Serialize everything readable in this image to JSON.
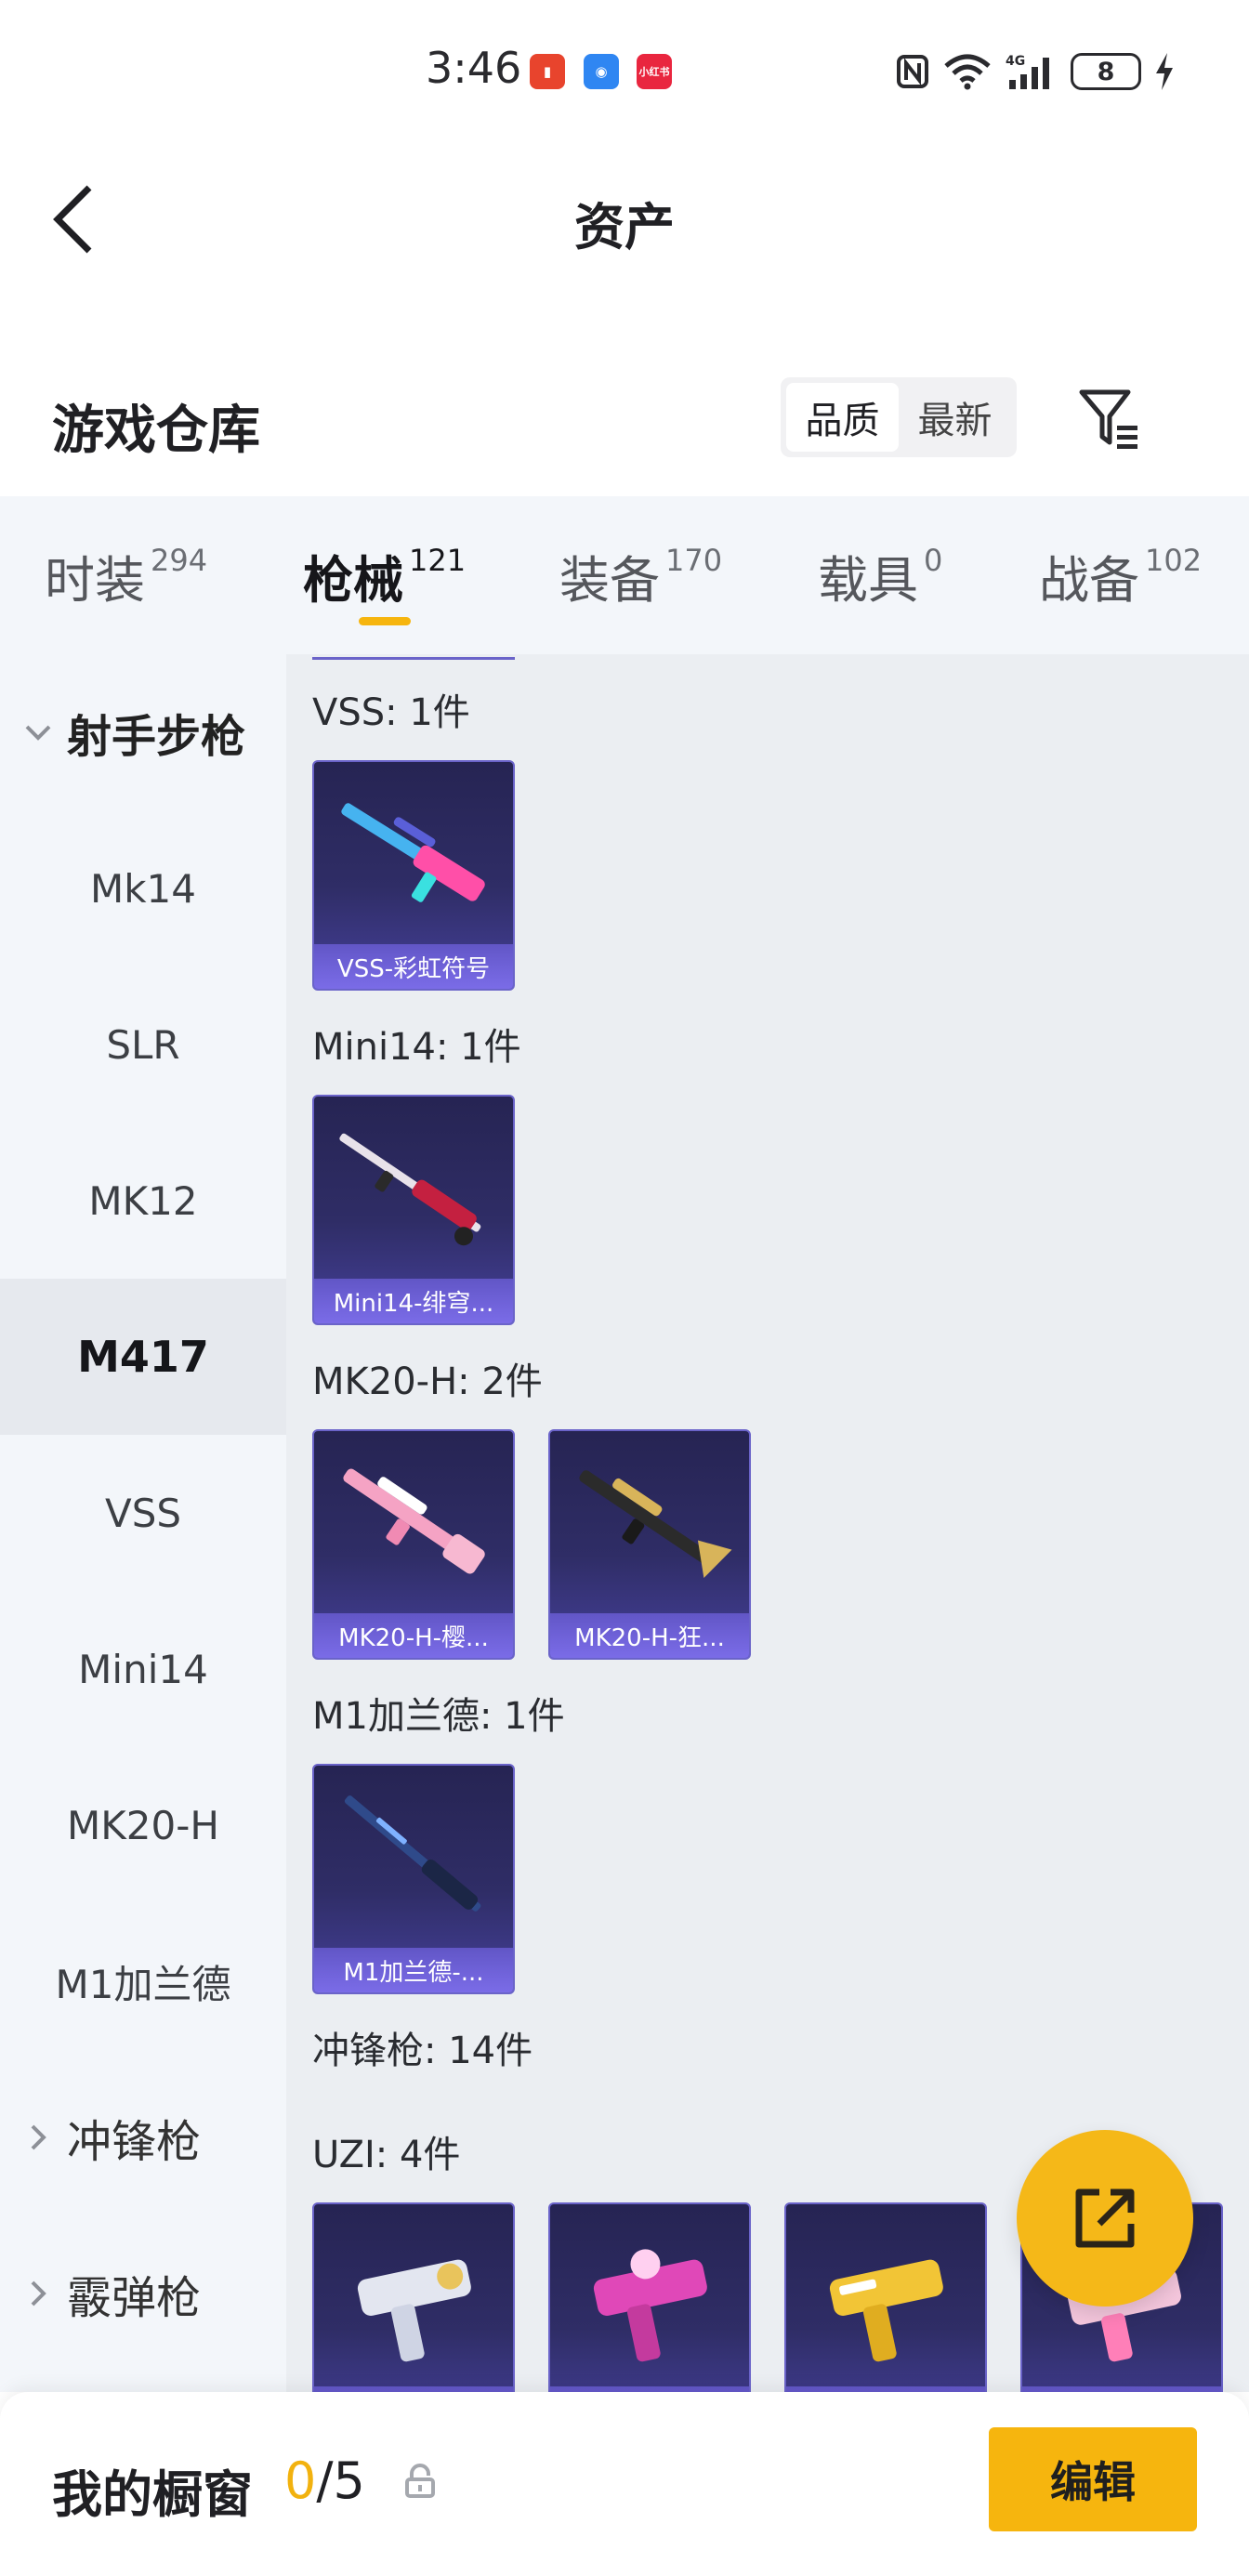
{
  "status_bar": {
    "time": "3:46",
    "notifications": [
      "notification-app-1",
      "notification-app-2",
      "小红书"
    ],
    "battery_level": "8"
  },
  "header": {
    "title": "资产"
  },
  "warehouse": {
    "title": "游戏仓库",
    "sort_options": [
      "品质",
      "最新"
    ],
    "sort_selected": "品质"
  },
  "category_tabs": [
    {
      "label": "时装",
      "count": "294"
    },
    {
      "label": "枪械",
      "count": "121",
      "active": true
    },
    {
      "label": "装备",
      "count": "170"
    },
    {
      "label": "载具",
      "count": "0"
    },
    {
      "label": "战备",
      "count": "102"
    }
  ],
  "sidebar": {
    "groups": [
      {
        "label": "射手步枪",
        "expanded": true
      },
      {
        "label": "冲锋枪",
        "expanded": false
      },
      {
        "label": "霰弹枪",
        "expanded": false
      }
    ],
    "items": [
      "Mk14",
      "SLR",
      "MK12",
      "M417",
      "VSS",
      "Mini14",
      "MK20-H",
      "M1加兰德"
    ],
    "active_item": "M417"
  },
  "sections": [
    {
      "label": "VSS: 1件",
      "cards": [
        {
          "name": "VSS-彩虹符号",
          "gun_color": "#46b3f0",
          "accent": "#ff4fa8"
        }
      ]
    },
    {
      "label": "Mini14: 1件",
      "cards": [
        {
          "name": "Mini14-绯穹...",
          "gun_color": "#e8e2ea",
          "accent": "#c42040"
        }
      ]
    },
    {
      "label": "MK20-H: 2件",
      "cards": [
        {
          "name": "MK20-H-樱...",
          "gun_color": "#f5a3c4",
          "accent": "#ffffff"
        },
        {
          "name": "MK20-H-狂...",
          "gun_color": "#2b2b2b",
          "accent": "#d8b45a"
        }
      ]
    },
    {
      "label": "M1加兰德: 1件",
      "cards": [
        {
          "name": "M1加兰德-...",
          "gun_color": "#2f4a8a",
          "accent": "#7fb2ff"
        }
      ]
    },
    {
      "label": "冲锋枪: 14件",
      "cards": []
    },
    {
      "label": "UZI: 4件",
      "cards": [
        {
          "name": "",
          "gun_color": "#e3e6f0",
          "accent": "#e9c45c"
        },
        {
          "name": "",
          "gun_color": "#e048b8",
          "accent": "#ffd0f0"
        },
        {
          "name": "",
          "gun_color": "#f2c536",
          "accent": "#ffffff"
        },
        {
          "name": "",
          "gun_color": "#f4c6dc",
          "accent": "#ff7fb8"
        }
      ]
    }
  ],
  "bottom_bar": {
    "showcase_label": "我的橱窗",
    "showcase_used": "0",
    "showcase_total": "/5",
    "edit_label": "编辑"
  },
  "colors": {
    "accent": "#f6b50e",
    "sidebar_bg": "#f3f6fa",
    "content_bg": "#ebeef2",
    "card_border": "#6a63c9"
  }
}
